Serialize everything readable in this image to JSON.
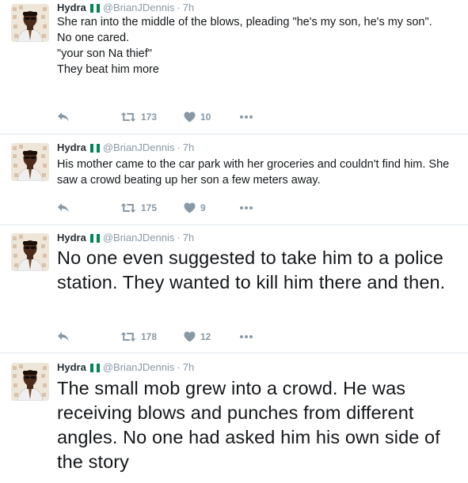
{
  "tweets": [
    {
      "name": "Hydra",
      "handle": "@BrianJDennis",
      "separator": "·",
      "time": "7h",
      "text": "She ran into the middle of the blows, pleading \"he's my son, he's my son\".\nNo one cared.\n\"your son Na thief\"\nThey beat him more",
      "retweets": "173",
      "likes": "10"
    },
    {
      "name": "Hydra",
      "handle": "@BrianJDennis",
      "separator": "·",
      "time": "7h",
      "text": "His mother came to the car park with her groceries and couldn't find him. She saw a crowd beating up her son a few meters away.",
      "retweets": "175",
      "likes": "9"
    },
    {
      "name": "Hydra",
      "handle": "@BrianJDennis",
      "separator": "·",
      "time": "7h",
      "text": "No one even suggested to take him to a police station. They wanted to kill him there and then.",
      "retweets": "178",
      "likes": "12"
    },
    {
      "name": "Hydra",
      "handle": "@BrianJDennis",
      "separator": "·",
      "time": "7h",
      "text": "The small mob grew into a crowd. He was receiving blows and punches from different angles. No one had asked him his own side of the story"
    }
  ],
  "colors": {
    "flag_green": "#008751",
    "icon_gray": "#8899a6",
    "divider": "#e1e8ed"
  },
  "icons": {
    "reply": "reply-arrow-icon",
    "retweet": "retweet-icon",
    "like": "heart-icon",
    "more": "more-dots-icon"
  }
}
